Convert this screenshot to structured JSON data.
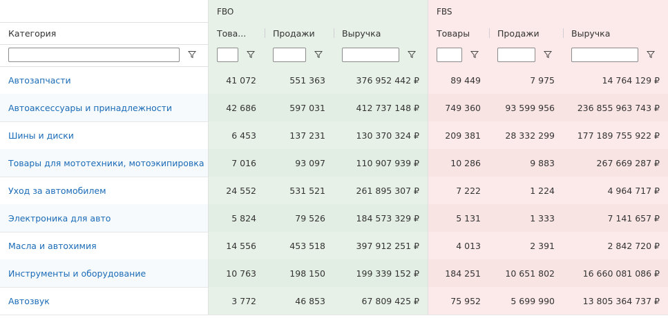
{
  "groups": {
    "blank": "",
    "fbo": "FBO",
    "fbs": "FBS"
  },
  "columns": {
    "category": "Категория",
    "fbo_goods": "Това...",
    "fbo_sales": "Продажи",
    "fbo_revenue": "Выручка",
    "fbs_goods": "Товары",
    "fbs_sales": "Продажи",
    "fbs_revenue": "Выручка"
  },
  "filters": {
    "category": "",
    "fbo_goods": "",
    "fbo_sales": "",
    "fbo_revenue": "",
    "fbs_goods": "",
    "fbs_sales": "",
    "fbs_revenue": ""
  },
  "icons": {
    "filter": "funnel-icon"
  },
  "colors": {
    "fbo": "#e7f1e8",
    "fbs": "#fce9e9",
    "link": "#1a6bb8"
  },
  "rows": [
    {
      "category": "Автозапчасти",
      "fbo_goods": "41 072",
      "fbo_sales": "551 363",
      "fbo_revenue": "376 952 442 ₽",
      "fbs_goods": "89 449",
      "fbs_sales": "7 975",
      "fbs_revenue": "14 764 129 ₽"
    },
    {
      "category": "Автоаксессуары и принадлежности",
      "fbo_goods": "42 686",
      "fbo_sales": "597 031",
      "fbo_revenue": "412 737 148 ₽",
      "fbs_goods": "749 360",
      "fbs_sales": "93 599 956",
      "fbs_revenue": "236 855 963 743 ₽"
    },
    {
      "category": "Шины и диски",
      "fbo_goods": "6 453",
      "fbo_sales": "137 231",
      "fbo_revenue": "130 370 324 ₽",
      "fbs_goods": "209 381",
      "fbs_sales": "28 332 299",
      "fbs_revenue": "177 189 755 922 ₽"
    },
    {
      "category": "Товары для мототехники, мотоэкипировка",
      "fbo_goods": "7 016",
      "fbo_sales": "93 097",
      "fbo_revenue": "110 907 939 ₽",
      "fbs_goods": "10 286",
      "fbs_sales": "9 883",
      "fbs_revenue": "267 669 287 ₽"
    },
    {
      "category": "Уход за автомобилем",
      "fbo_goods": "24 552",
      "fbo_sales": "531 521",
      "fbo_revenue": "261 895 307 ₽",
      "fbs_goods": "7 222",
      "fbs_sales": "1 224",
      "fbs_revenue": "4 964 717 ₽"
    },
    {
      "category": "Электроника для авто",
      "fbo_goods": "5 824",
      "fbo_sales": "79 526",
      "fbo_revenue": "184 573 329 ₽",
      "fbs_goods": "5 131",
      "fbs_sales": "1 333",
      "fbs_revenue": "7 141 657 ₽"
    },
    {
      "category": "Масла и автохимия",
      "fbo_goods": "14 556",
      "fbo_sales": "453 518",
      "fbo_revenue": "397 912 251 ₽",
      "fbs_goods": "4 013",
      "fbs_sales": "2 391",
      "fbs_revenue": "2 842 720 ₽"
    },
    {
      "category": "Инструменты и оборудование",
      "fbo_goods": "10 763",
      "fbo_sales": "198 150",
      "fbo_revenue": "199 339 152 ₽",
      "fbs_goods": "184 251",
      "fbs_sales": "10 651 802",
      "fbs_revenue": "16 660 081 086 ₽"
    },
    {
      "category": "Автозвук",
      "fbo_goods": "3 772",
      "fbo_sales": "46 853",
      "fbo_revenue": "67 809 425 ₽",
      "fbs_goods": "75 952",
      "fbs_sales": "5 699 990",
      "fbs_revenue": "13 805 364 737 ₽"
    }
  ]
}
